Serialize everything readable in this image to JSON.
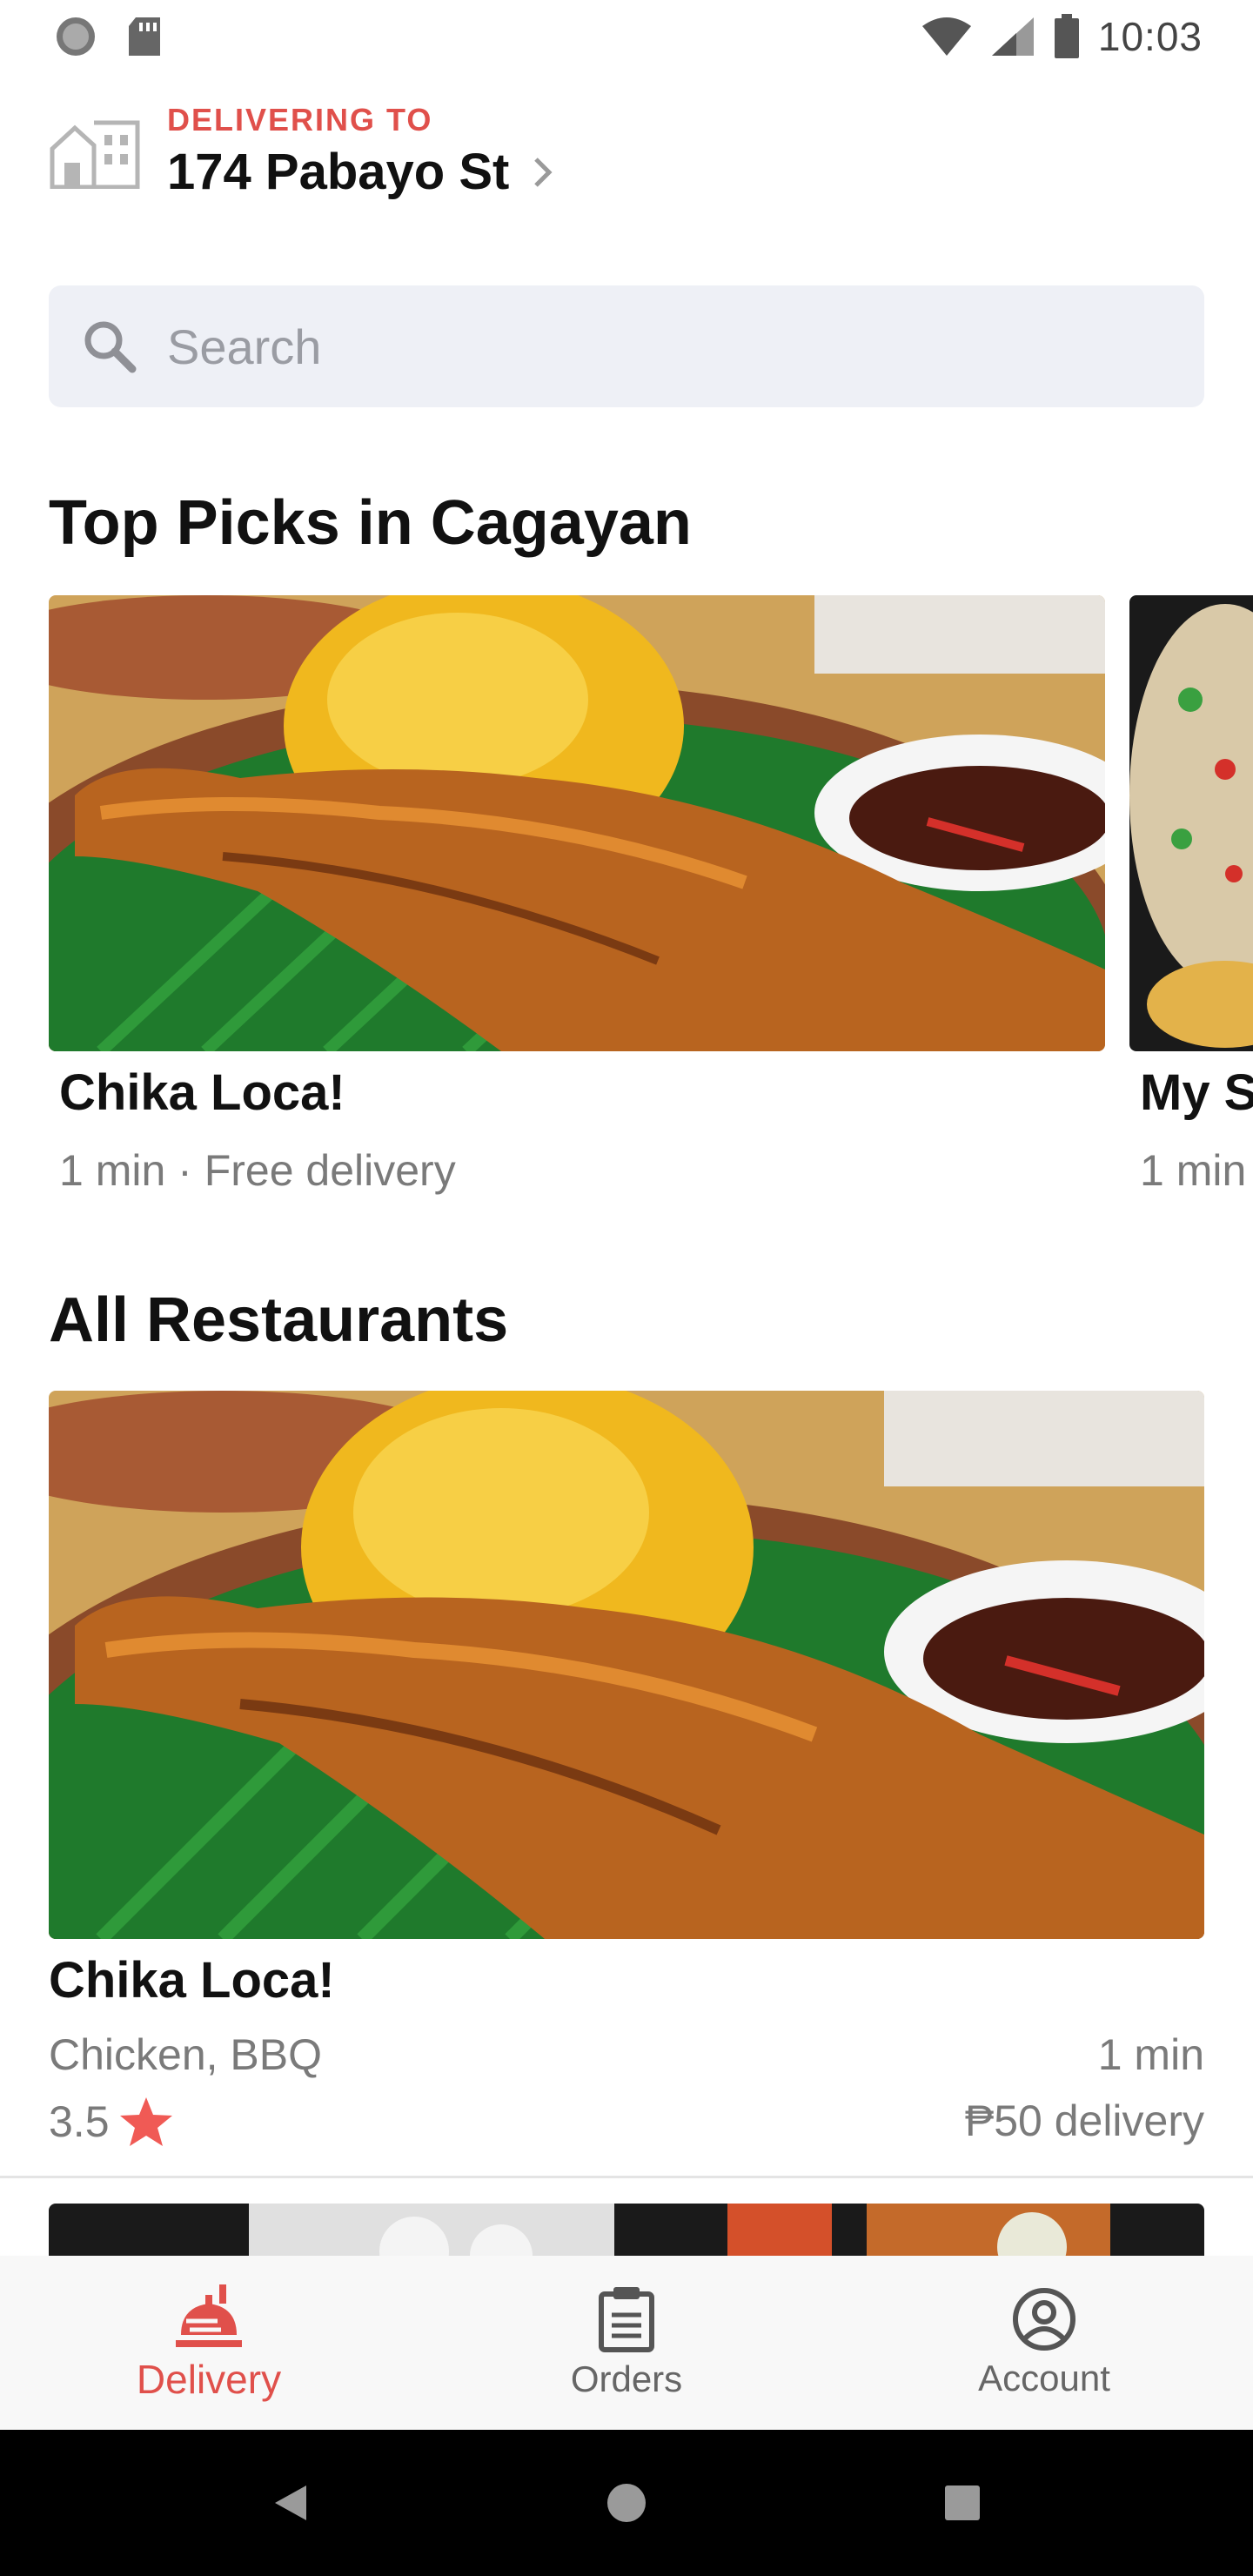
{
  "status_bar": {
    "time": "10:03"
  },
  "header": {
    "delivering_label": "DELIVERING TO",
    "address": "174 Pabayo St"
  },
  "search": {
    "placeholder": "Search"
  },
  "top_picks": {
    "title": "Top Picks in Cagayan",
    "cards": [
      {
        "name": "Chika Loca!",
        "subtitle": "1 min · Free delivery"
      },
      {
        "name": "My S",
        "subtitle": "1 min"
      }
    ]
  },
  "all_restaurants": {
    "title": "All Restaurants",
    "items": [
      {
        "name": "Chika Loca!",
        "cuisine": "Chicken, BBQ",
        "rating": "3.5",
        "time": "1 min",
        "delivery_fee": "₱50 delivery"
      }
    ]
  },
  "bottom_nav": {
    "items": [
      {
        "label": "Delivery",
        "icon": "delivery-icon",
        "active": true
      },
      {
        "label": "Orders",
        "icon": "clipboard-icon",
        "active": false
      },
      {
        "label": "Account",
        "icon": "account-icon",
        "active": false
      }
    ]
  },
  "colors": {
    "accent": "#e0504b",
    "search_bg": "#eef0f6",
    "muted_text": "#7a7a7a",
    "star": "#f05a55"
  }
}
